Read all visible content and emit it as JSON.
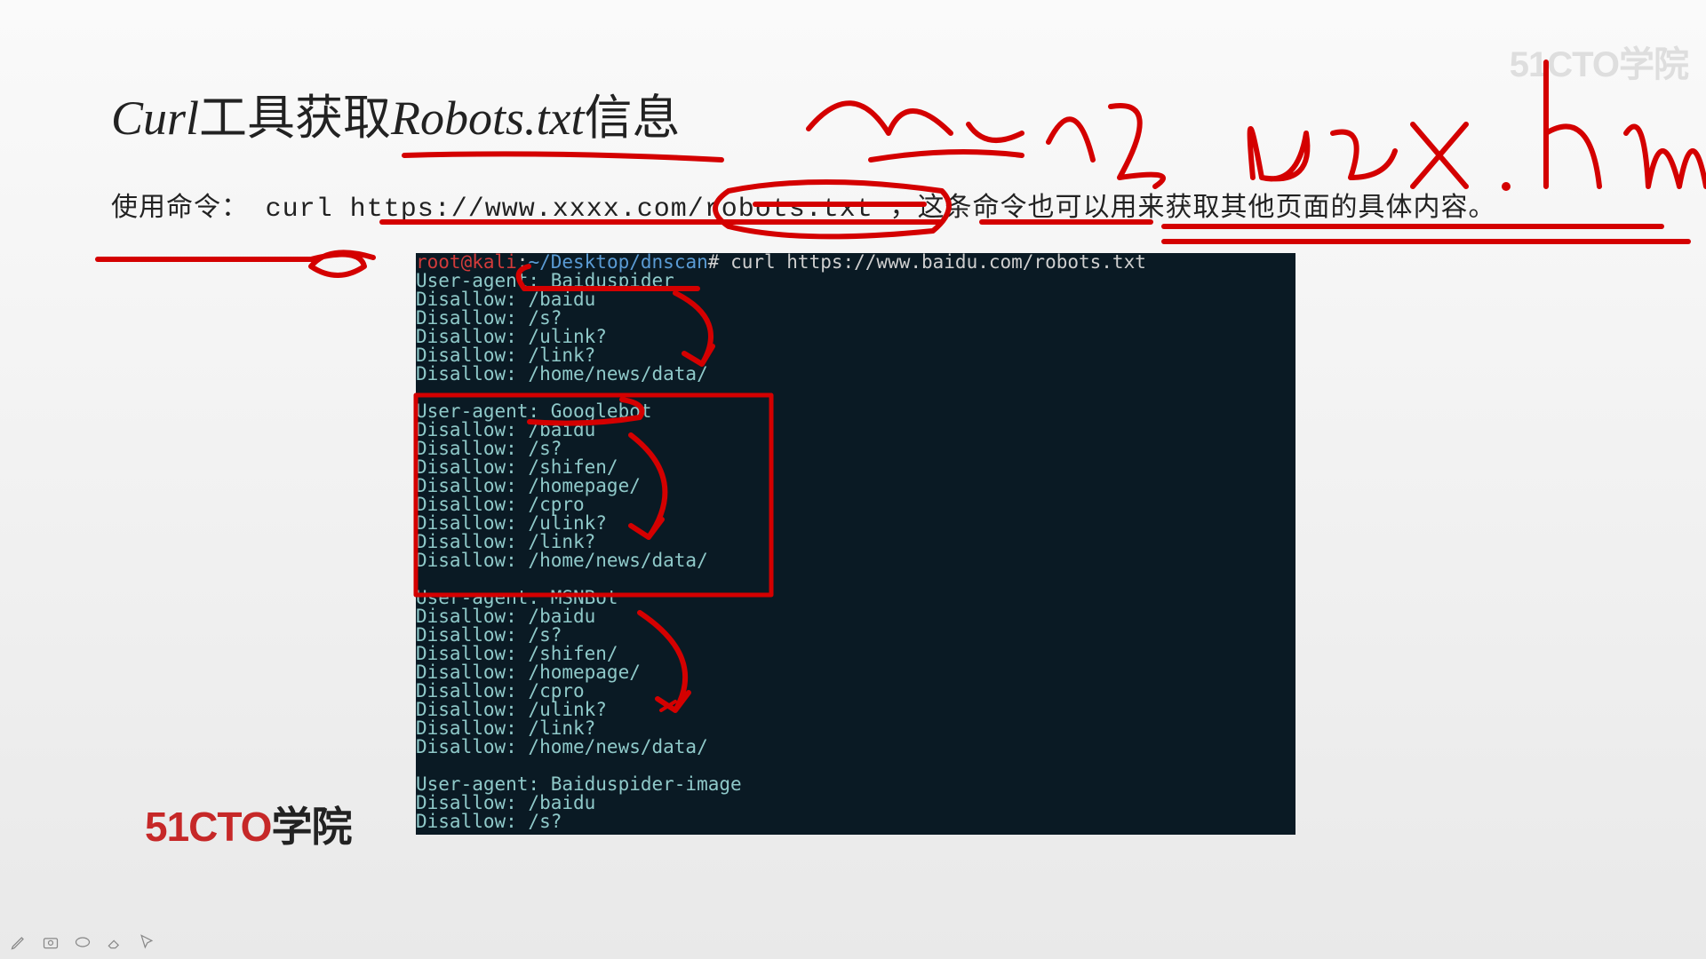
{
  "title_prefix": "Curl",
  "title_cn": "工具获取",
  "title_suffix": "Robots.txt",
  "title_tail": "信息",
  "subtitle_label": "使用命令：",
  "subtitle_cmd": "curl https://www.xxxx.com/robots.txt",
  "subtitle_tail": "，这条命令也可以用来获取其他页面的具体内容。",
  "prompt": {
    "user": "root@kali",
    "sep": ":",
    "path": "~/Desktop/dnscan",
    "hash": "#",
    "cmd": "curl https://www.baidu.com/robots.txt"
  },
  "output": {
    "block1_ua": "User-agent: Baiduspider",
    "block1": [
      "Disallow: /baidu",
      "Disallow: /s?",
      "Disallow: /ulink?",
      "Disallow: /link?",
      "Disallow: /home/news/data/"
    ],
    "block2_ua": "User-agent: Googlebot",
    "block2": [
      "Disallow: /baidu",
      "Disallow: /s?",
      "Disallow: /shifen/",
      "Disallow: /homepage/",
      "Disallow: /cpro",
      "Disallow: /ulink?",
      "Disallow: /link?",
      "Disallow: /home/news/data/"
    ],
    "block3_ua": "User-agent: MSNBot",
    "block3": [
      "Disallow: /baidu",
      "Disallow: /s?",
      "Disallow: /shifen/",
      "Disallow: /homepage/",
      "Disallow: /cpro",
      "Disallow: /ulink?",
      "Disallow: /link?",
      "Disallow: /home/news/data/"
    ],
    "block4_ua": "User-agent: Baiduspider-image",
    "block4": [
      "Disallow: /baidu",
      "Disallow: /s?"
    ]
  },
  "logo_en": "51CTO",
  "logo_cn": "学院",
  "watermark": "51CTO学院",
  "annotation_color": "#d40000"
}
